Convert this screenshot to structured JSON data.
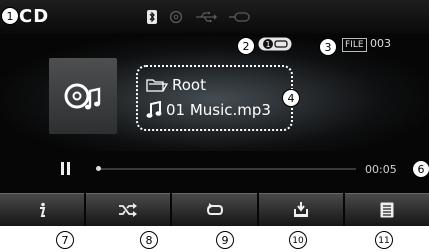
{
  "header": {
    "source_label": "CD",
    "icons": [
      "bluetooth-icon",
      "disc-status-icon",
      "usb-icon",
      "aux-icon"
    ]
  },
  "playback": {
    "repeat_badge": "1",
    "file_badge": "FILE",
    "file_number": "003",
    "folder_name": "Root",
    "track_name": "01 Music.mp3",
    "elapsed_time": "00:05",
    "progress_fraction": 0.01,
    "state": "paused"
  },
  "buttons": [
    {
      "name": "info-button",
      "icon": "info-icon"
    },
    {
      "name": "shuffle-button",
      "icon": "shuffle-icon"
    },
    {
      "name": "repeat-button",
      "icon": "repeat-icon"
    },
    {
      "name": "copy-button",
      "icon": "copy-icon"
    },
    {
      "name": "list-button",
      "icon": "list-icon"
    }
  ],
  "callouts": {
    "c1": "1",
    "c2": "2",
    "c3": "3",
    "c4": "4",
    "c6": "6",
    "c7": "7",
    "c8": "8",
    "c9": "9",
    "c10": "10",
    "c11": "11"
  }
}
